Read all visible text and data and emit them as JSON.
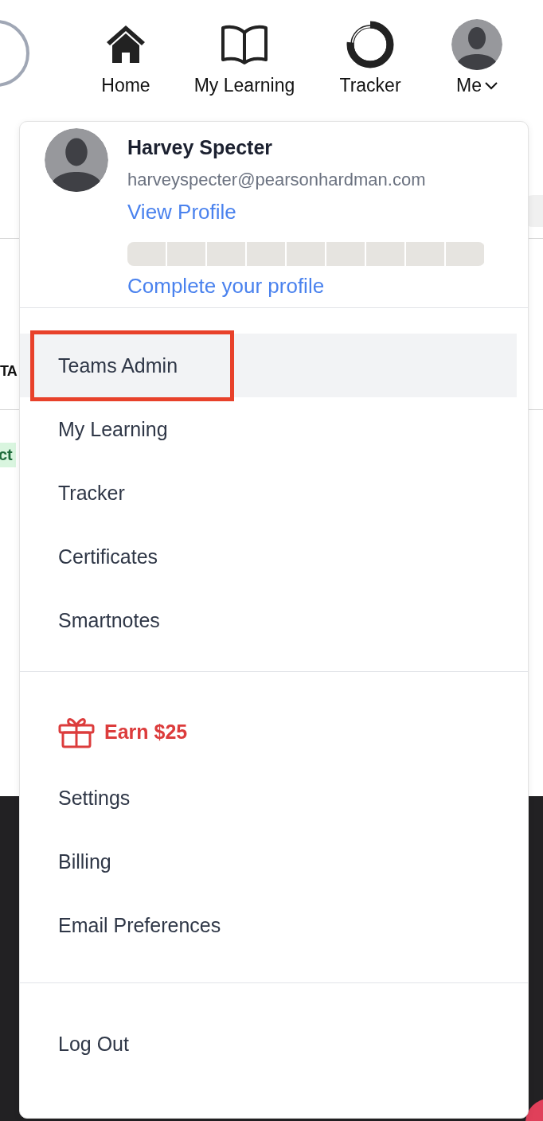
{
  "nav": {
    "items": [
      {
        "label": "Home",
        "kind": "home"
      },
      {
        "label": "My Learning",
        "kind": "book"
      },
      {
        "label": "Tracker",
        "kind": "tracker"
      },
      {
        "label": "Me",
        "kind": "me"
      }
    ]
  },
  "background": {
    "heading_fragment": "TA",
    "badge_fragment": "ct"
  },
  "menu": {
    "profile": {
      "name": "Harvey Specter",
      "email": "harveyspecter@pearsonhardman.com",
      "link": "View Profile",
      "progress": {
        "level": 0
      },
      "cta": "Complete your profile"
    },
    "sections": [
      [
        {
          "label": "Teams Admin",
          "selected": true,
          "annotated": true,
          "kind": "link"
        },
        {
          "label": "My Learning",
          "selected": false,
          "annotated": false,
          "kind": "link"
        },
        {
          "label": "Tracker",
          "selected": false,
          "annotated": false,
          "kind": "link"
        },
        {
          "label": "Certificates",
          "selected": false,
          "annotated": false,
          "kind": "link"
        },
        {
          "label": "Smartnotes",
          "selected": false,
          "annotated": false,
          "kind": "link"
        }
      ],
      [
        {
          "label": "Earn $25",
          "selected": false,
          "annotated": false,
          "kind": "reward"
        },
        {
          "label": "Settings",
          "selected": false,
          "annotated": false,
          "kind": "link"
        },
        {
          "label": "Billing",
          "selected": false,
          "annotated": false,
          "kind": "link"
        },
        {
          "label": "Email Preferences",
          "selected": false,
          "annotated": false,
          "kind": "link"
        }
      ],
      [
        {
          "label": "Log Out",
          "selected": false,
          "annotated": false,
          "kind": "link"
        }
      ]
    ]
  }
}
